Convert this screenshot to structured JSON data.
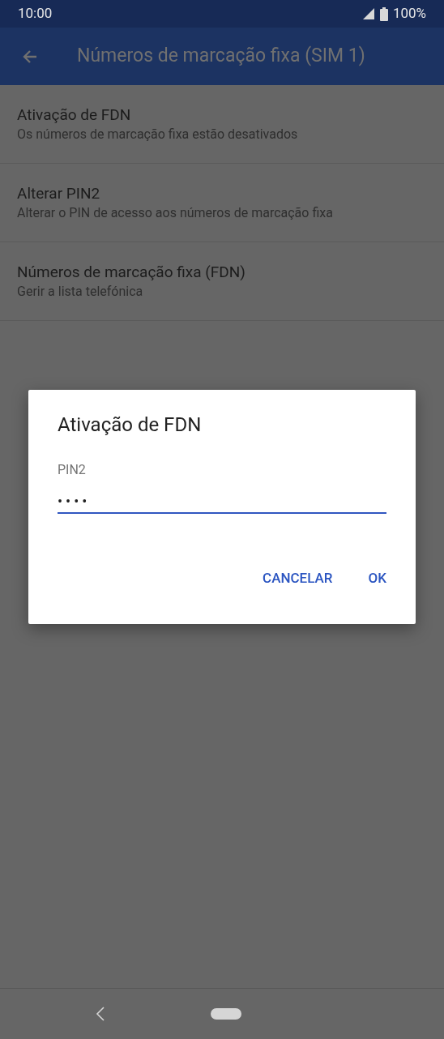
{
  "status_bar": {
    "time": "10:00",
    "battery": "100%"
  },
  "app_bar": {
    "title": "Números de marcação fixa (SIM 1)"
  },
  "settings": [
    {
      "title": "Ativação de FDN",
      "subtitle": "Os números de marcação fixa estão desativados"
    },
    {
      "title": "Alterar PIN2",
      "subtitle": "Alterar o PIN de acesso aos números de marcação fixa"
    },
    {
      "title": "Números de marcação fixa (FDN)",
      "subtitle": "Gerir a lista telefónica"
    }
  ],
  "dialog": {
    "title": "Ativação de FDN",
    "field": {
      "label": "PIN2",
      "value": "••••"
    },
    "buttons": [
      "CANCELAR",
      "OK"
    ]
  }
}
